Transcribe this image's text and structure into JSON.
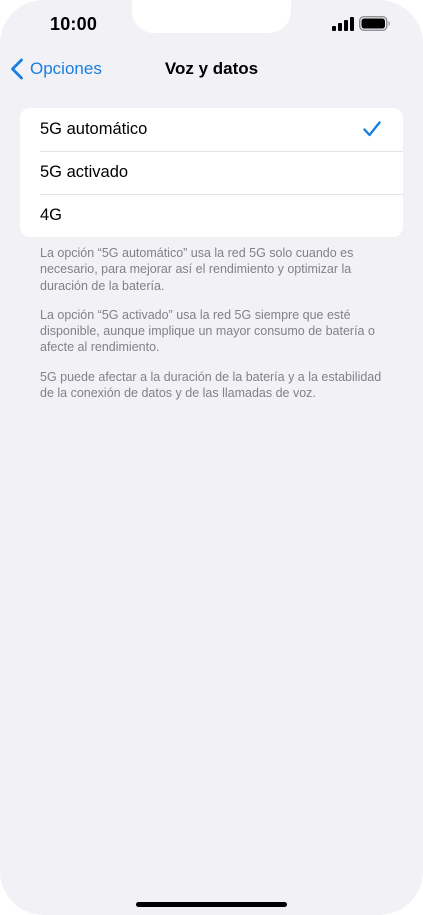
{
  "status_bar": {
    "time": "10:00",
    "signal_icon": "cellular-signal-icon",
    "battery_icon": "battery-icon"
  },
  "nav": {
    "back_label": "Opciones",
    "back_icon": "chevron-left-icon",
    "title": "Voz y datos"
  },
  "options": [
    {
      "label": "5G automático",
      "selected": true
    },
    {
      "label": "5G activado",
      "selected": false
    },
    {
      "label": "4G",
      "selected": false
    }
  ],
  "footnotes": [
    "La opción “5G automático” usa la red 5G solo cuando es necesario, para mejorar así el rendimiento y optimizar la duración de la batería.",
    "La opción “5G activado” usa la red 5G siempre que esté disponible, aunque implique un mayor consumo de batería o afecte al rendimiento.",
    "5G puede afectar a la duración de la batería y a la estabilidad de la conexión de datos y de las llamadas de voz."
  ],
  "colors": {
    "accent": "#1a7fe2",
    "background": "#f2f1f6",
    "footnote_text": "#82818a"
  }
}
